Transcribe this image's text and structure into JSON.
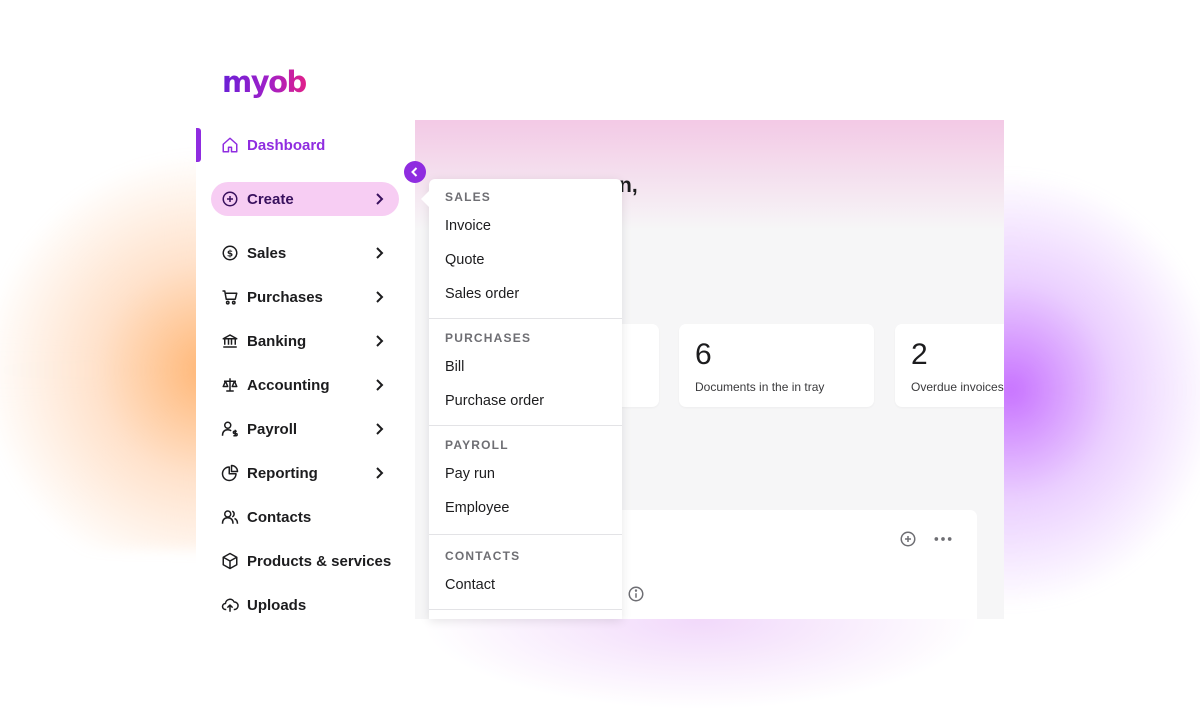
{
  "app": {
    "logo": "myob"
  },
  "colors": {
    "accent": "#8f2ce0",
    "create_bg": "#f7cdf3",
    "main_bg": "#f6f6f7"
  },
  "sidebar": {
    "items": [
      {
        "label": "Dashboard",
        "icon": "home-icon",
        "active": true
      },
      {
        "label": "Create",
        "icon": "plus-circle-icon",
        "expanded": true
      },
      {
        "label": "Sales",
        "icon": "dollar-circle-icon"
      },
      {
        "label": "Purchases",
        "icon": "cart-icon"
      },
      {
        "label": "Banking",
        "icon": "bank-icon"
      },
      {
        "label": "Accounting",
        "icon": "scales-icon"
      },
      {
        "label": "Payroll",
        "icon": "person-dollar-icon"
      },
      {
        "label": "Reporting",
        "icon": "pie-chart-icon"
      },
      {
        "label": "Contacts",
        "icon": "people-icon"
      },
      {
        "label": "Products & services",
        "icon": "box-icon"
      },
      {
        "label": "Uploads",
        "icon": "upload-cloud-icon"
      }
    ]
  },
  "main": {
    "greeting_fragment": "n,",
    "cards": [
      {
        "number": "6",
        "label": "Documents in the in tray"
      },
      {
        "number": "2",
        "label": "Overdue invoices"
      }
    ]
  },
  "create_menu": {
    "sections": [
      {
        "heading": "SALES",
        "items": [
          "Invoice",
          "Quote",
          "Sales order"
        ]
      },
      {
        "heading": "PURCHASES",
        "items": [
          "Bill",
          "Purchase order"
        ]
      },
      {
        "heading": "PAYROLL",
        "items": [
          "Pay run",
          "Employee"
        ]
      },
      {
        "heading": "CONTACTS",
        "items": [
          "Contact"
        ]
      }
    ]
  }
}
